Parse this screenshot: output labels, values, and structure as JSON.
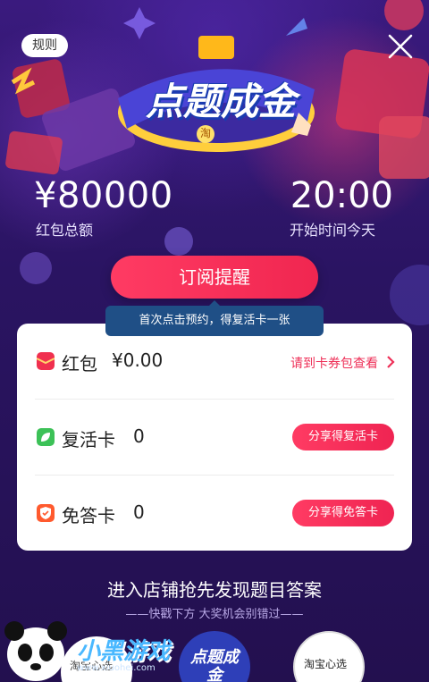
{
  "header": {
    "rules_label": "规则",
    "logo_text": "点题成金",
    "logo_badge": "淘"
  },
  "prize": {
    "amount": "¥80000",
    "amount_label": "红包总额",
    "start_time": "20:00",
    "start_time_label": "开始时间今天"
  },
  "subscribe": {
    "button_label": "订阅提醒",
    "tip": "首次点击预约，得复活卡一张"
  },
  "card": {
    "rows": [
      {
        "label": "红包",
        "value": "¥0.00",
        "action": "请到卡券包查看",
        "icon": "red-envelope-icon",
        "icon_color": "#f0304f"
      },
      {
        "label": "复活卡",
        "value": "0",
        "action": "分享得复活卡",
        "icon": "leaf-icon",
        "icon_color": "#3cc157"
      },
      {
        "label": "免答卡",
        "value": "0",
        "action": "分享得免答卡",
        "icon": "shield-icon",
        "icon_color": "#ff5a2e"
      }
    ]
  },
  "footer": {
    "title": "进入店铺抢先发现题目答案",
    "subtitle": "——快戳下方 大奖机会别错过——",
    "shops": [
      {
        "label": "淘宝心选"
      },
      {
        "label": "点题成金"
      },
      {
        "label": "淘宝心选"
      }
    ]
  },
  "watermark": {
    "text": "小黑游戏",
    "url": "www.xiuohei.com"
  },
  "colors": {
    "accent": "#f02650",
    "background": "#2a1460",
    "tip_background": "#1f4f86"
  }
}
